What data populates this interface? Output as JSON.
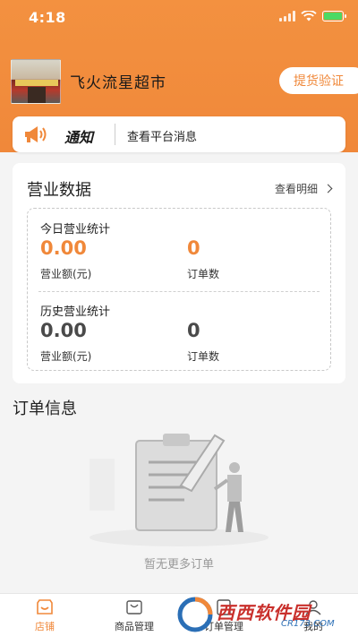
{
  "status_bar": {
    "time": "4:18"
  },
  "store": {
    "name": "飞火流星超市",
    "pickup_button": "提货验证"
  },
  "notice": {
    "tag": "通知",
    "text": "查看平台消息"
  },
  "business": {
    "title": "营业数据",
    "detail_link": "查看明细",
    "today": {
      "heading": "今日营业统计",
      "revenue_value": "0.00",
      "revenue_label": "营业额(元)",
      "orders_value": "0",
      "orders_label": "订单数"
    },
    "history": {
      "heading": "历史营业统计",
      "revenue_value": "0.00",
      "revenue_label": "营业额(元)",
      "orders_value": "0",
      "orders_label": "订单数"
    }
  },
  "orders": {
    "title": "订单信息",
    "empty_text": "暂无更多订单"
  },
  "tabbar": {
    "items": [
      {
        "label": "店铺",
        "icon": "store-icon",
        "active": true
      },
      {
        "label": "商品管理",
        "icon": "bag-icon",
        "active": false
      },
      {
        "label": "订单管理",
        "icon": "order-icon",
        "active": false
      },
      {
        "label": "我的",
        "icon": "user-icon",
        "active": false
      }
    ]
  },
  "watermark": {
    "text": "西西软件园",
    "sub": "CR173.COM"
  },
  "colors": {
    "accent": "#f0883a",
    "background": "#f4f4f4"
  }
}
